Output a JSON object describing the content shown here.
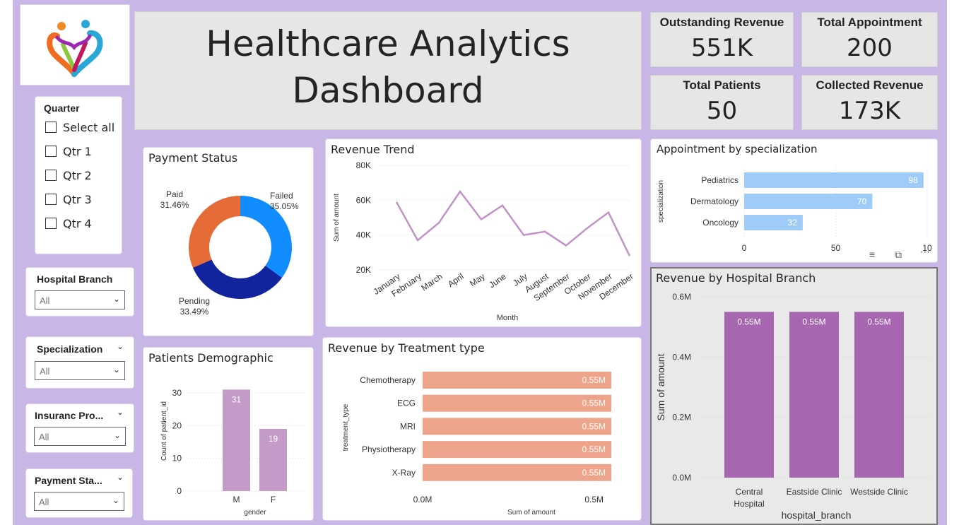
{
  "dashboard": {
    "title_line1": "Healthcare Analytics",
    "title_line2": "Dashboard"
  },
  "kpis": {
    "outstanding": {
      "label": "Outstanding Revenue",
      "value": "551K"
    },
    "appointments": {
      "label": "Total Appointment",
      "value": "200"
    },
    "patients": {
      "label": "Total Patients",
      "value": "50"
    },
    "collected": {
      "label": "Collected Revenue",
      "value": "173K"
    }
  },
  "slicers": {
    "quarter": {
      "title": "Quarter",
      "options": [
        "Select all",
        "Qtr 1",
        "Qtr 2",
        "Qtr 3",
        "Qtr 4"
      ]
    },
    "branch": {
      "title": "Hospital Branch",
      "value": "All"
    },
    "specialization": {
      "title": "Specialization",
      "value": "All"
    },
    "insurance": {
      "title": "Insuranc Pro...",
      "value": "All"
    },
    "payment": {
      "title": "Payment Sta...",
      "value": "All"
    }
  },
  "visuals": {
    "payment_status": {
      "title": "Payment Status"
    },
    "revenue_trend": {
      "title": "Revenue Trend"
    },
    "specialization": {
      "title": "Appointment by specialization"
    },
    "branch": {
      "title": "Revenue by Hospital Branch"
    },
    "demographic": {
      "title": "Patients Demographic"
    },
    "treatment": {
      "title": "Revenue by Treatment type"
    }
  },
  "colors": {
    "canvas": "#c8b7e6",
    "line": "#c291c9",
    "donut_failed": "#118dff",
    "donut_paid": "#e66c37",
    "donut_pending": "#12239e",
    "spec_bar": "#9ecbf7",
    "branch_bar": "#a666b0",
    "demo_bar": "#c49ac9",
    "treat_bar": "#eea48a"
  },
  "chart_data": [
    {
      "id": "payment_status",
      "type": "pie",
      "title": "Payment Status",
      "labels": [
        "Failed",
        "Pending",
        "Paid"
      ],
      "values": [
        35.05,
        33.49,
        31.46
      ],
      "value_labels": [
        "35.05%",
        "33.49%",
        "31.46%"
      ],
      "donut": true
    },
    {
      "id": "revenue_trend",
      "type": "line",
      "title": "Revenue Trend",
      "xlabel": "Month",
      "ylabel": "Sum of amount",
      "categories": [
        "January",
        "February",
        "March",
        "April",
        "May",
        "June",
        "July",
        "August",
        "September",
        "October",
        "November",
        "December"
      ],
      "values": [
        59000,
        37000,
        47000,
        65000,
        49000,
        57000,
        40000,
        42000,
        34000,
        44000,
        53000,
        28000
      ],
      "ylim": [
        20000,
        80000
      ],
      "yticks": [
        "20K",
        "40K",
        "60K",
        "80K"
      ],
      "ytick_values": [
        20000,
        40000,
        60000,
        80000
      ]
    },
    {
      "id": "specialization",
      "type": "bar",
      "orientation": "horizontal",
      "title": "Appointment by specialization",
      "ylabel": "specialization",
      "categories": [
        "Pediatrics",
        "Dermatology",
        "Oncology"
      ],
      "values": [
        98,
        70,
        32
      ],
      "xlim": [
        0,
        100
      ],
      "xticks": [
        "0",
        "50",
        "10"
      ],
      "xtick_values": [
        0,
        50,
        100
      ]
    },
    {
      "id": "branch",
      "type": "bar",
      "title": "Revenue by Hospital Branch",
      "xlabel": "hospital_branch",
      "ylabel": "Sum of amount",
      "categories": [
        "Central Hospital",
        "Eastside Clinic",
        "Westside Clinic"
      ],
      "category_lines": [
        [
          "Central",
          "Hospital"
        ],
        [
          "Eastside Clinic"
        ],
        [
          "Westside Clinic"
        ]
      ],
      "values": [
        0.55,
        0.55,
        0.55
      ],
      "value_labels": [
        "0.55M",
        "0.55M",
        "0.55M"
      ],
      "ylim": [
        0,
        0.6
      ],
      "yticks": [
        "0.0M",
        "0.2M",
        "0.4M",
        "0.6M"
      ],
      "ytick_values": [
        0,
        0.2,
        0.4,
        0.6
      ]
    },
    {
      "id": "demographic",
      "type": "bar",
      "title": "Patients Demographic",
      "xlabel": "gender",
      "ylabel": "Count of patient_id",
      "categories": [
        "M",
        "F"
      ],
      "values": [
        31,
        19
      ],
      "ylim": [
        0,
        33
      ],
      "yticks": [
        "0",
        "10",
        "20",
        "30"
      ],
      "ytick_values": [
        0,
        10,
        20,
        30
      ]
    },
    {
      "id": "treatment",
      "type": "bar",
      "orientation": "horizontal",
      "title": "Revenue by Treatment type",
      "xlabel": "Sum of amount",
      "ylabel": "treatment_type",
      "categories": [
        "Chemotherapy",
        "ECG",
        "MRI",
        "Physiotherapy",
        "X-Ray"
      ],
      "values": [
        0.55,
        0.55,
        0.55,
        0.55,
        0.55
      ],
      "value_labels": [
        "0.55M",
        "0.55M",
        "0.55M",
        "0.55M",
        "0.55M"
      ],
      "xlim": [
        0,
        0.55
      ],
      "xticks": [
        "0.0M",
        "0.5M"
      ],
      "xtick_values": [
        0,
        0.5
      ]
    }
  ]
}
